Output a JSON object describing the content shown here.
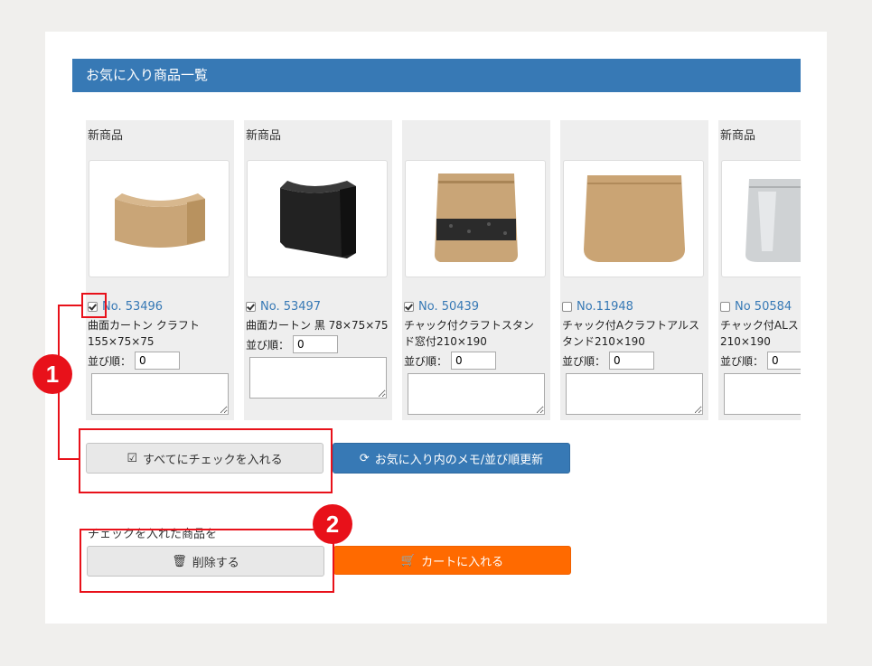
{
  "header": {
    "title": "お気に入り商品一覧"
  },
  "products": [
    {
      "tag": "新商品",
      "number": "No. 53496",
      "name": "曲面カートン クラフト\n155×75×75",
      "order_label": "並び順：",
      "order_value": "0",
      "checked": true,
      "image": "kraft-curved-carton"
    },
    {
      "tag": "新商品",
      "number": "No. 53497",
      "name": "曲面カートン 黒 78×75×75",
      "order_label": "並び順：",
      "order_value": "0",
      "checked": true,
      "image": "black-curved-carton"
    },
    {
      "tag": "",
      "number": "No. 50439",
      "name": "チャック付クラフトスタン\nド窓付210×190",
      "order_label": "並び順：",
      "order_value": "0",
      "checked": true,
      "image": "kraft-stand-pouch-window"
    },
    {
      "tag": "",
      "number": "No.11948",
      "name": "チャック付Aクラフトアルス\nタンド210×190",
      "order_label": "並び順：",
      "order_value": "0",
      "checked": false,
      "image": "kraft-stand-pouch"
    },
    {
      "tag": "新商品",
      "number": "No 50584",
      "name": "チャック付ALス\n210×190",
      "order_label": "並び順：",
      "order_value": "0",
      "checked": false,
      "image": "aluminum-stand-pouch"
    }
  ],
  "actions": {
    "check_all": "すべてにチェックを入れる",
    "update": "お気に入り内のメモ/並び順更新",
    "selected_label": "チェックを入れた商品を",
    "delete": "削除する",
    "cart": "カートに入れる"
  },
  "annotations": {
    "badge1": "1",
    "badge2": "2"
  },
  "colors": {
    "header": "#3779b5",
    "orange": "#ff6a00",
    "annotation_red": "#e8111a"
  },
  "icons": {
    "check_all": "check-square-icon",
    "update": "refresh-icon",
    "delete": "trash-icon",
    "cart": "cart-icon"
  }
}
